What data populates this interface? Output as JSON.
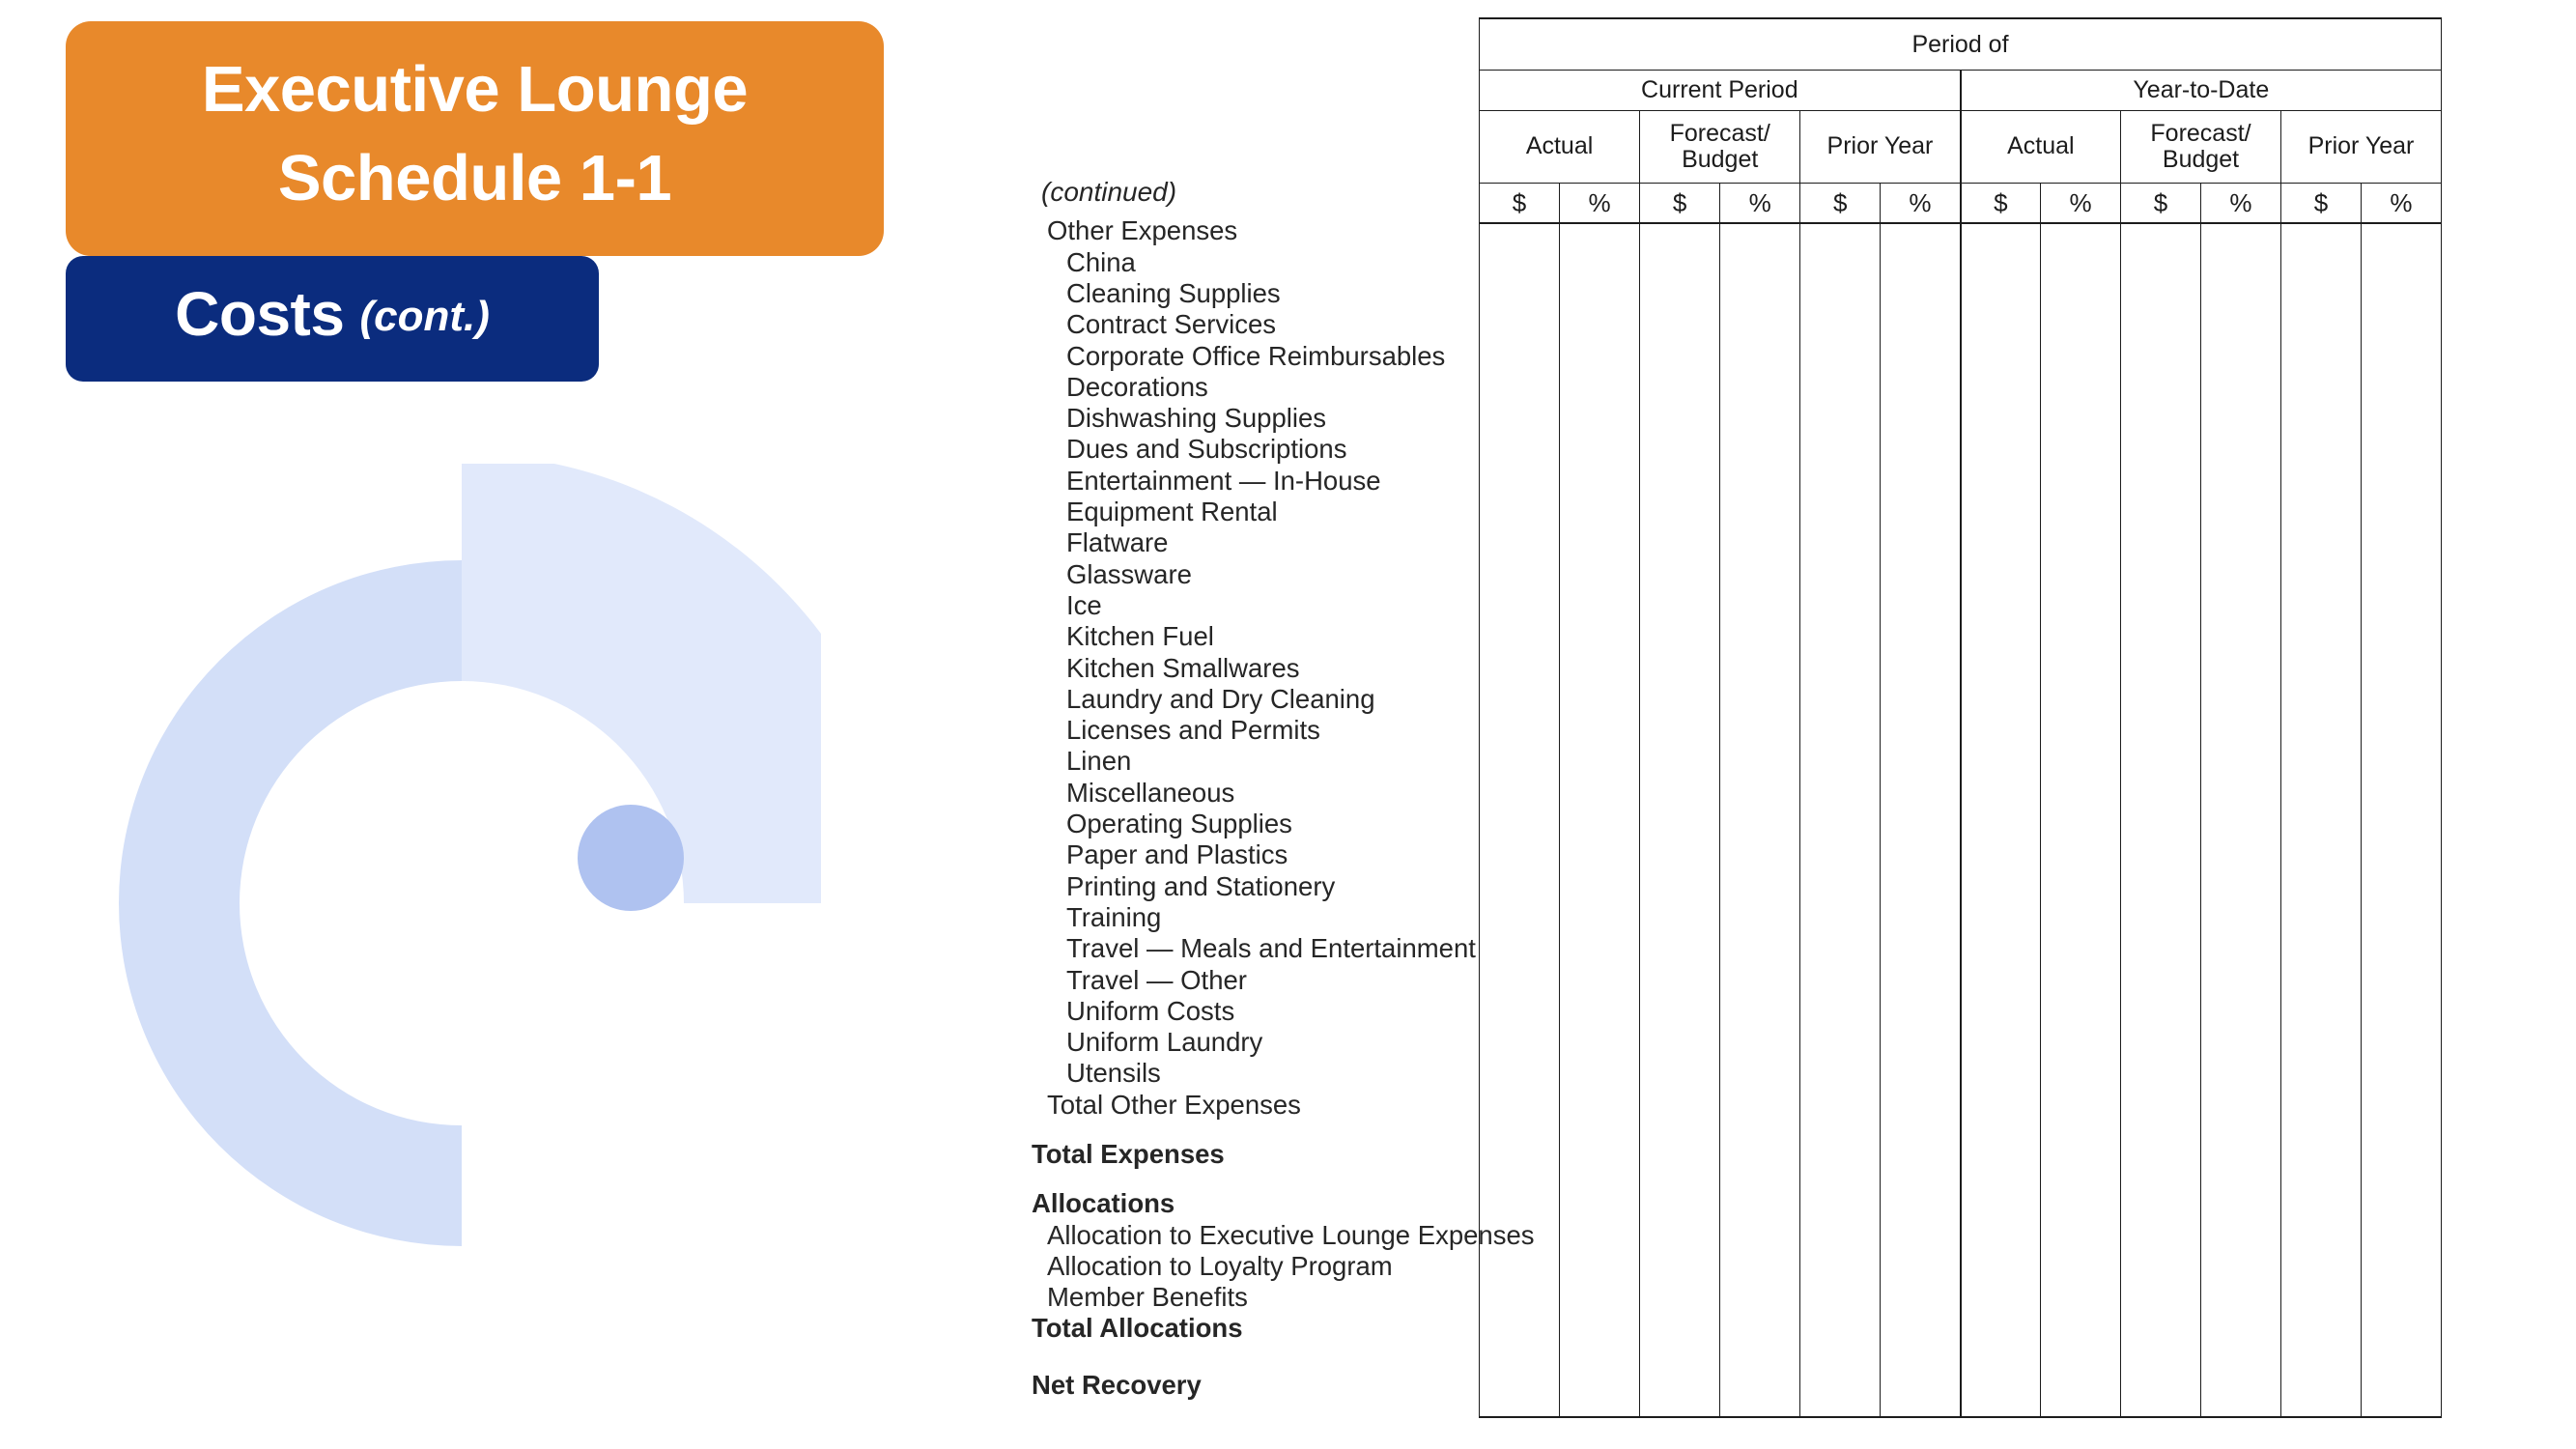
{
  "title": {
    "orange_line1": "Executive Lounge",
    "orange_line2": "Schedule 1-1",
    "orange_color": "#E8892B",
    "blue_main": "Costs",
    "blue_sub": "(cont.)",
    "blue_color": "#0B2C7E"
  },
  "decoration": {
    "arc_color": "#D3DFF8",
    "arc_light_color": "#E1E9FB",
    "dot_color": "#AFC2F0"
  },
  "list": {
    "continued": "(continued)",
    "items": [
      {
        "label": "Other Expenses",
        "level": 0,
        "bold": false
      },
      {
        "label": "China",
        "level": 1,
        "bold": false
      },
      {
        "label": "Cleaning Supplies",
        "level": 1,
        "bold": false
      },
      {
        "label": "Contract Services",
        "level": 1,
        "bold": false
      },
      {
        "label": "Corporate Office Reimbursables",
        "level": 1,
        "bold": false
      },
      {
        "label": "Decorations",
        "level": 1,
        "bold": false
      },
      {
        "label": "Dishwashing Supplies",
        "level": 1,
        "bold": false
      },
      {
        "label": "Dues and Subscriptions",
        "level": 1,
        "bold": false
      },
      {
        "label": "Entertainment — In-House",
        "level": 1,
        "bold": false
      },
      {
        "label": "Equipment Rental",
        "level": 1,
        "bold": false
      },
      {
        "label": "Flatware",
        "level": 1,
        "bold": false
      },
      {
        "label": "Glassware",
        "level": 1,
        "bold": false
      },
      {
        "label": "Ice",
        "level": 1,
        "bold": false
      },
      {
        "label": "Kitchen Fuel",
        "level": 1,
        "bold": false
      },
      {
        "label": "Kitchen Smallwares",
        "level": 1,
        "bold": false
      },
      {
        "label": "Laundry and Dry Cleaning",
        "level": 1,
        "bold": false
      },
      {
        "label": "Licenses and Permits",
        "level": 1,
        "bold": false
      },
      {
        "label": "Linen",
        "level": 1,
        "bold": false
      },
      {
        "label": "Miscellaneous",
        "level": 1,
        "bold": false
      },
      {
        "label": "Operating Supplies",
        "level": 1,
        "bold": false
      },
      {
        "label": "Paper and Plastics",
        "level": 1,
        "bold": false
      },
      {
        "label": "Printing and Stationery",
        "level": 1,
        "bold": false
      },
      {
        "label": "Training",
        "level": 1,
        "bold": false
      },
      {
        "label": "Travel — Meals and Entertainment",
        "level": 1,
        "bold": false
      },
      {
        "label": "Travel — Other",
        "level": 1,
        "bold": false
      },
      {
        "label": "Uniform Costs",
        "level": 1,
        "bold": false
      },
      {
        "label": "Uniform Laundry",
        "level": 1,
        "bold": false
      },
      {
        "label": "Utensils",
        "level": 1,
        "bold": false
      },
      {
        "label": "Total Other Expenses",
        "level": 0,
        "bold": false
      },
      {
        "label": "",
        "level": "gap-md",
        "bold": false
      },
      {
        "label": "Total Expenses",
        "level": 2,
        "bold": true
      },
      {
        "label": "",
        "level": "gap-md",
        "bold": false
      },
      {
        "label": "Allocations",
        "level": 2,
        "bold": true
      },
      {
        "label": "Allocation to Executive Lounge Expenses",
        "level": 0,
        "bold": false
      },
      {
        "label": "Allocation to Loyalty Program",
        "level": 0,
        "bold": false
      },
      {
        "label": "Member Benefits",
        "level": 0,
        "bold": false
      },
      {
        "label": "Total Allocations",
        "level": 2,
        "bold": true
      },
      {
        "label": "",
        "level": "gap-lg",
        "bold": false
      },
      {
        "label": "Net Recovery",
        "level": 2,
        "bold": true
      }
    ]
  },
  "table": {
    "period_of": "Period of",
    "groups": [
      {
        "label": "Current Period"
      },
      {
        "label": "Year-to-Date"
      }
    ],
    "columns": [
      {
        "label_line1": "Actual",
        "label_line2": ""
      },
      {
        "label_line1": "Forecast/",
        "label_line2": "Budget"
      },
      {
        "label_line1": "Prior Year",
        "label_line2": ""
      },
      {
        "label_line1": "Actual",
        "label_line2": ""
      },
      {
        "label_line1": "Forecast/",
        "label_line2": "Budget"
      },
      {
        "label_line1": "Prior Year",
        "label_line2": ""
      }
    ],
    "units": [
      "$",
      "%",
      "$",
      "%",
      "$",
      "%",
      "$",
      "%",
      "$",
      "%",
      "$",
      "%"
    ]
  }
}
